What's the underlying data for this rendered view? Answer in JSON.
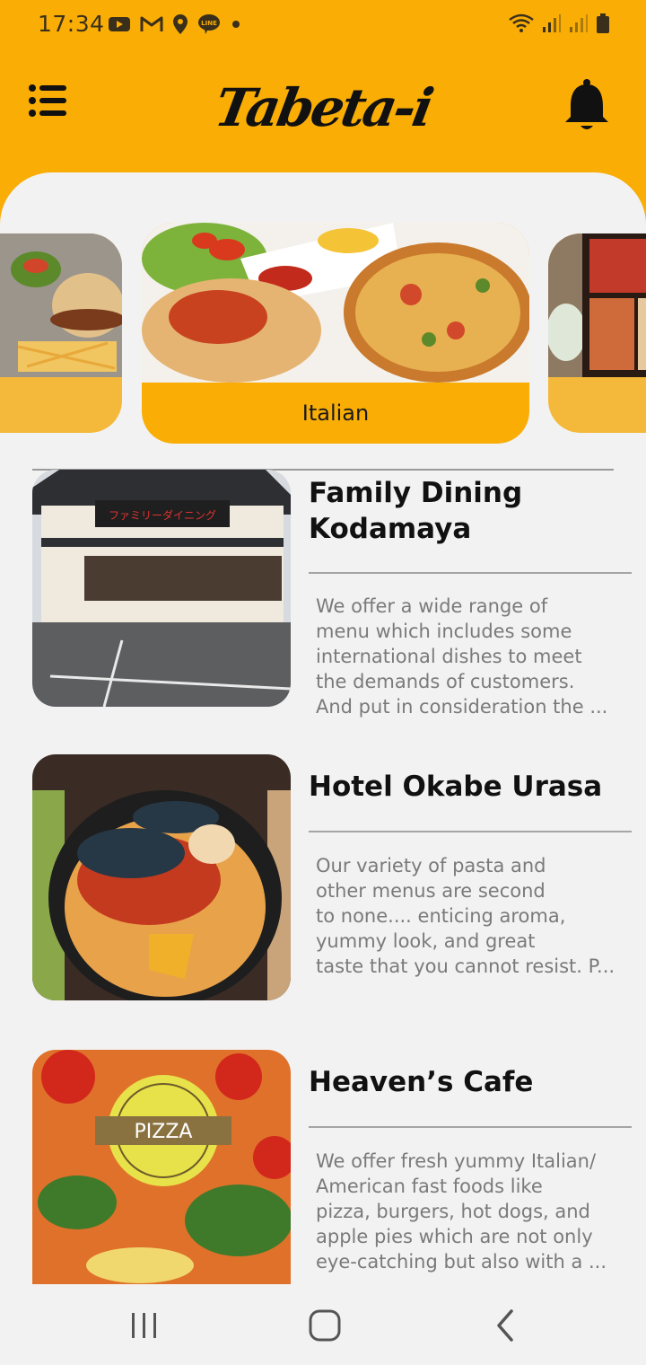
{
  "status_bar": {
    "time": "17:34",
    "left_icons": [
      "youtube-icon",
      "gmail-icon",
      "location-icon",
      "line-icon",
      "dot-icon"
    ],
    "right_icons": [
      "wifi-icon",
      "signal-icon",
      "signal-icon",
      "battery-icon"
    ]
  },
  "header": {
    "title": "Tabeta-i",
    "menu_icon": "menu-icon",
    "bell_icon": "bell-icon"
  },
  "colors": {
    "accent": "#f9ad05",
    "card_side": "#f4b93a",
    "background": "#f2f2f2",
    "desc_text": "#7a7a7a"
  },
  "categories": [
    {
      "label": "",
      "image": "burger-plate"
    },
    {
      "label": "Italian",
      "image": "pasta-and-pizza"
    },
    {
      "label": "",
      "image": "bento-box"
    }
  ],
  "restaurants": [
    {
      "title": "Family Dining\nKodamaya",
      "image": "restaurant-exterior",
      "description": "We offer a wide range of\nmenu which includes some\ninternational dishes to meet\nthe demands of customers.\nAnd put in consideration the ..."
    },
    {
      "title": "Hotel Okabe Urasa",
      "image": "seafood-pasta",
      "description": "Our variety of pasta and\nother menus are second\nto none.... enticing aroma,\nyummy look, and great\ntaste that you cannot resist. P..."
    },
    {
      "title": "Heaven’s Cafe",
      "image": "pizza-logo",
      "description": "We offer fresh yummy Italian/\nAmerican fast foods like\npizza, burgers, hot dogs, and\napple pies which are not only\neye-catching but also with a ..."
    }
  ],
  "nav_bar": {
    "buttons": [
      "recent-apps-icon",
      "home-icon",
      "back-icon"
    ]
  }
}
